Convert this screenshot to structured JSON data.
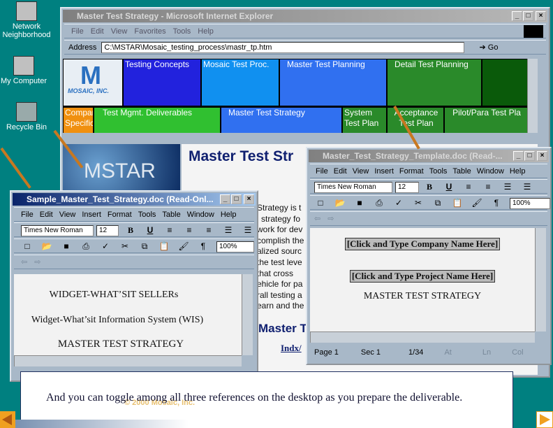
{
  "desktop": {
    "icons": [
      {
        "label": "Network Neighborhood",
        "icon": "network-icon"
      },
      {
        "label": "My Computer",
        "icon": "computer-icon"
      },
      {
        "label": "Recycle Bin",
        "icon": "recycle-bin-icon"
      }
    ]
  },
  "ie": {
    "title": "Master Test Strategy - Microsoft Internet Explorer",
    "menu": [
      "File",
      "Edit",
      "View",
      "Favorites",
      "Tools",
      "Help"
    ],
    "address_label": "Address",
    "address": "C:\\MSTAR\\Mosaic_testing_process\\mastr_tp.htm",
    "go": "Go",
    "logo_text": "MOSAIC, INC.",
    "map_top": [
      "Testing Concepts",
      "Mosaic Test Proc.",
      "Master Test Planning",
      "Detail Test Planning"
    ],
    "map_bottom": [
      "Company Specific",
      "Test Mgmt. Deliverables",
      "Master Test Strategy",
      "System Test Plan",
      "Acceptance Test Plan",
      "Pilot/Para Test Pla"
    ],
    "banner": "MSTAR",
    "heading": "Master Test Str",
    "body_lines": [
      "Strategy is t",
      "l strategy fo",
      "work for dev",
      "complish the",
      "alized sourc",
      "the test leve",
      "that cross",
      "ehicle for pa",
      "rall testing a",
      "earn and the"
    ],
    "subheading": "Master T",
    "link": "Indx/"
  },
  "word_left": {
    "title": "Sample_Master_Test_Strategy.doc (Read-Onl...",
    "menu": [
      "File",
      "Edit",
      "View",
      "Insert",
      "Format",
      "Tools",
      "Table",
      "Window",
      "Help"
    ],
    "font": "Times New Roman",
    "size": "12",
    "zoom": "100%",
    "doc_lines": [
      "WIDGET-WHAT’SIT SELLERs",
      "Widget-What’sit Information System (WIS)",
      "MASTER TEST STRATEGY"
    ]
  },
  "word_right": {
    "title": "Master_Test_Strategy_Template.doc (Read-...",
    "menu": [
      "File",
      "Edit",
      "View",
      "Insert",
      "Format",
      "Tools",
      "Table",
      "Window",
      "Help"
    ],
    "font": "Times New Roman",
    "size": "12",
    "zoom": "100%",
    "doc_lines": [
      "[Click and Type Company Name Here]",
      "[Click and Type Project Name Here]",
      "MASTER TEST STRATEGY"
    ],
    "status": {
      "page": "Page 1",
      "sec": "Sec 1",
      "pages": "1/34",
      "at": "At",
      "ln": "Ln",
      "col": "Col"
    }
  },
  "caption": {
    "text": "And you can toggle among all three references on the desktop as you prepare the deliverable.",
    "copyright": "© 2000 Mosaic, Inc."
  },
  "nav": {
    "prev": "previous-slide",
    "next": "next-slide"
  },
  "colors": {
    "desktop": "#008080",
    "accent_orange": "#c87820"
  }
}
